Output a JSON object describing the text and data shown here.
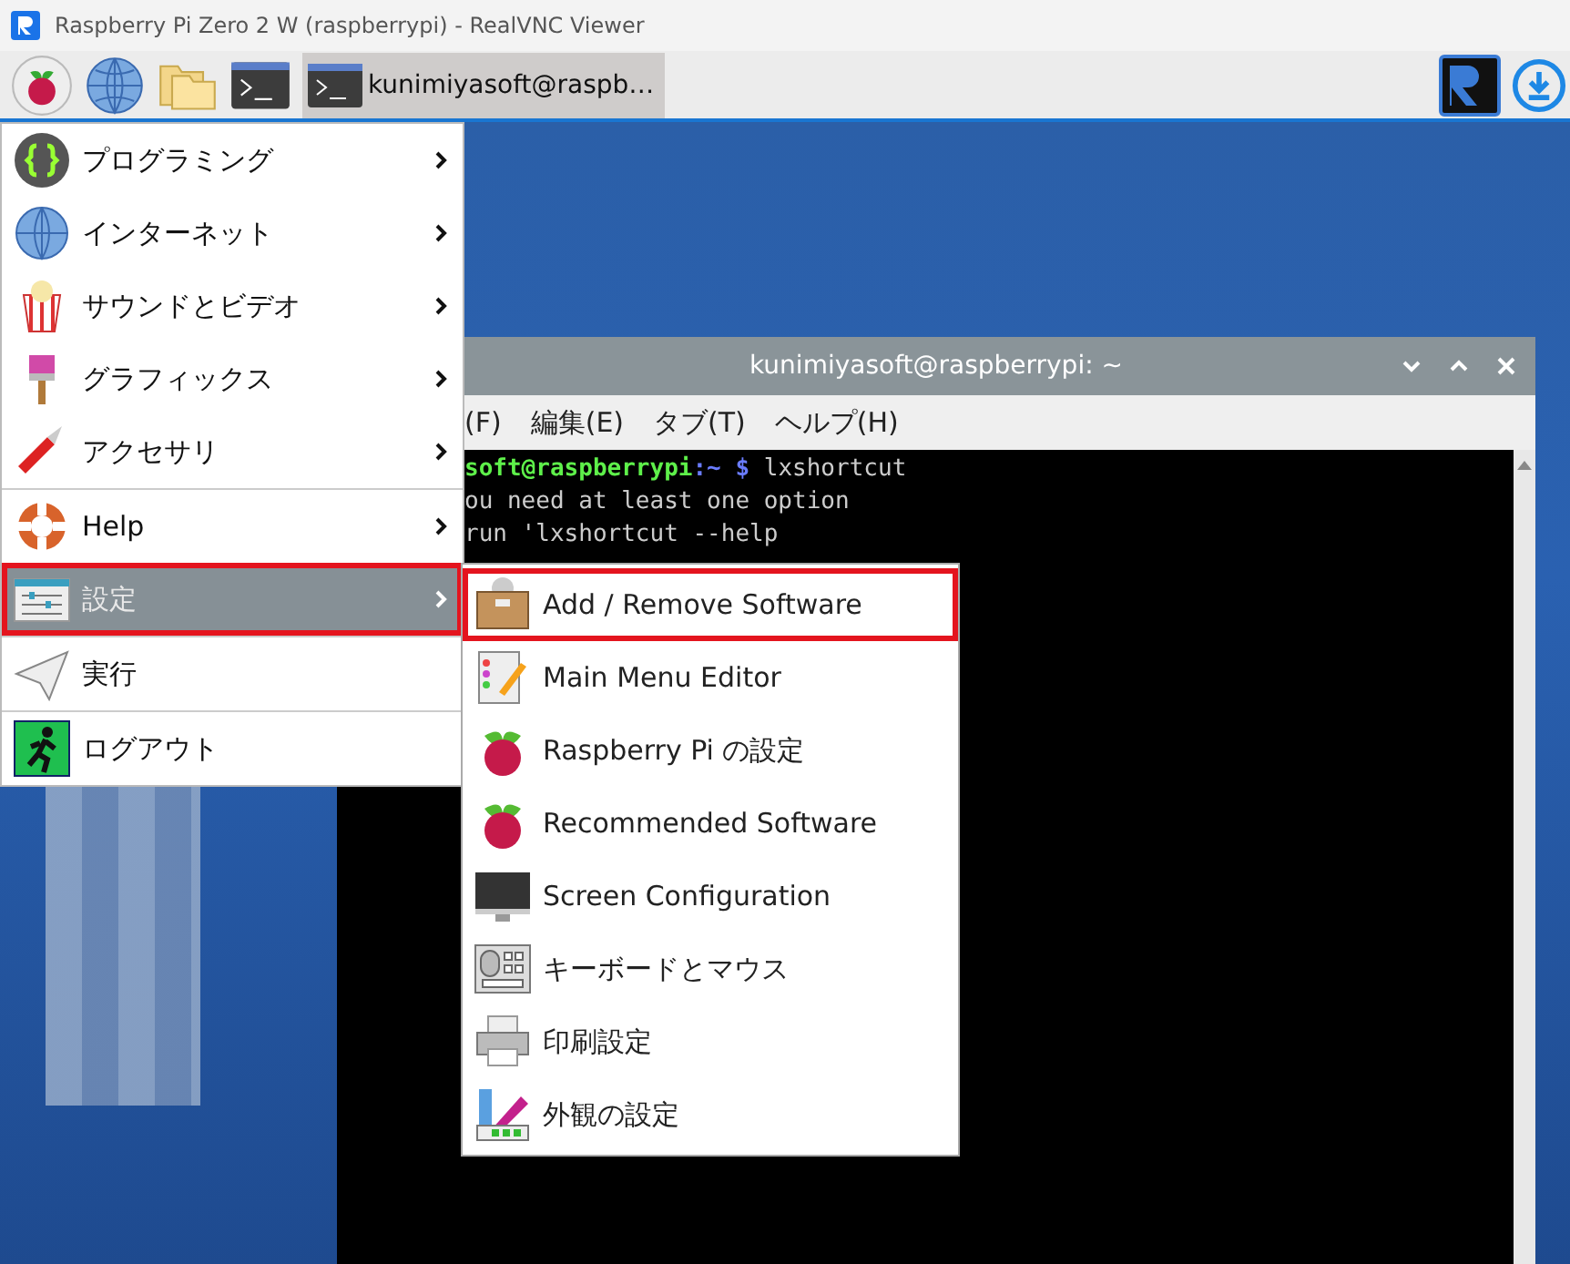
{
  "window": {
    "title": "Raspberry Pi Zero 2 W (raspberrypi) - RealVNC Viewer"
  },
  "taskbar": {
    "task": {
      "label": "kunimiyasoft@raspb…",
      "selected": true
    }
  },
  "main_menu": {
    "groups": [
      [
        {
          "label": "プログラミング",
          "has_submenu": true,
          "selected": false,
          "highlighted": false
        },
        {
          "label": "インターネット",
          "has_submenu": true,
          "selected": false,
          "highlighted": false
        },
        {
          "label": "サウンドとビデオ",
          "has_submenu": true,
          "selected": false,
          "highlighted": false
        },
        {
          "label": "グラフィックス",
          "has_submenu": true,
          "selected": false,
          "highlighted": false
        },
        {
          "label": "アクセサリ",
          "has_submenu": true,
          "selected": false,
          "highlighted": false
        }
      ],
      [
        {
          "label": "Help",
          "has_submenu": true,
          "selected": false,
          "highlighted": false
        },
        {
          "label": "設定",
          "has_submenu": true,
          "selected": true,
          "highlighted": true
        }
      ],
      [
        {
          "label": "実行",
          "has_submenu": false,
          "selected": false,
          "highlighted": false
        }
      ],
      [
        {
          "label": "ログアウト",
          "has_submenu": false,
          "selected": false,
          "highlighted": false
        }
      ]
    ]
  },
  "submenu": {
    "items": [
      {
        "label": "Add / Remove Software",
        "highlighted": true
      },
      {
        "label": "Main Menu Editor",
        "highlighted": false
      },
      {
        "label": "Raspberry Pi の設定",
        "highlighted": false
      },
      {
        "label": "Recommended Software",
        "highlighted": false
      },
      {
        "label": "Screen Configuration",
        "highlighted": false
      },
      {
        "label": "キーボードとマウス",
        "highlighted": false
      },
      {
        "label": "印刷設定",
        "highlighted": false
      },
      {
        "label": "外観の設定",
        "highlighted": false
      }
    ]
  },
  "terminal": {
    "title": "kunimiyasoft@raspberrypi: ~",
    "menus": [
      "(F)",
      "編集(E)",
      "タブ(T)",
      "ヘルプ(H)"
    ],
    "prompt": {
      "user_host": "soft@raspberrypi",
      "path": ":~",
      "symbol": "$",
      "command": "lxshortcut"
    },
    "output": [
      "ou need at least one option",
      "run 'lxshortcut --help"
    ]
  }
}
